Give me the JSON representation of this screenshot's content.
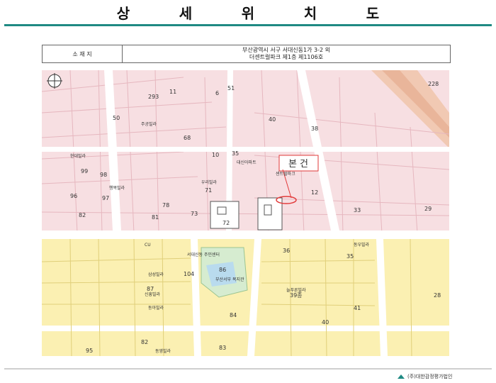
{
  "title": {
    "chars": [
      "상",
      "세",
      "위",
      "치",
      "도"
    ]
  },
  "location": {
    "label": "소 재 지",
    "address_line1": "부산광역시 서구 서대신동1가 3-2 외",
    "address_line2": "더센트럴파크 제1층 제1106호"
  },
  "map": {
    "target_label": "본 건",
    "lot_numbers": [
      "51",
      "11",
      "6",
      "228",
      "293",
      "50",
      "40",
      "38",
      "68",
      "35",
      "10",
      "98",
      "99",
      "97",
      "96",
      "71",
      "78",
      "73",
      "72",
      "12",
      "33",
      "81",
      "82",
      "29",
      "36",
      "104",
      "86",
      "87",
      "39종",
      "35",
      "28",
      "84",
      "41",
      "40",
      "95",
      "82",
      "83"
    ],
    "place_names": [
      "주공빌라",
      "대신아파트",
      "현대빌라",
      "행복빌라",
      "센트럴파크",
      "우리빌라",
      "늘푸른빌라",
      "삼성빌라",
      "동아빌라",
      "동영빌라",
      "신흥빌라",
      "CU",
      "서대신동 주민센터",
      "부산서부 복지관",
      "동우빌라"
    ]
  },
  "footer": {
    "company": "(주)대한감정평가법인"
  },
  "colors": {
    "accent": "#1f8a83",
    "residential_pink": "#f7dfe2",
    "commercial_yellow": "#fbf0b2",
    "road": "#ffffff",
    "park": "#d6ecd0",
    "target_red": "#e23a3a"
  },
  "icons": [
    "compass-icon",
    "company-logo-icon"
  ]
}
